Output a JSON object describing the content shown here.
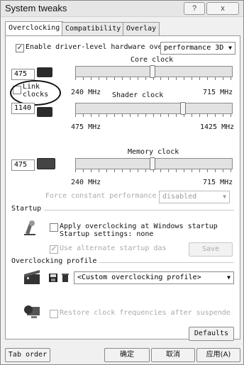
{
  "window": {
    "title": "System tweaks",
    "help_label": "?",
    "close_label": "x"
  },
  "tabs": [
    "Overclocking",
    "Compatibility",
    "Overlay"
  ],
  "overclocking": {
    "enable_label": "Enable driver-level hardware overc",
    "enable_checked": true,
    "profile_mode": "performance 3D",
    "link_clocks_label": "Link clocks",
    "link_clocks_checked": false,
    "core": {
      "title": "Core clock",
      "value": "475",
      "min_label": "240 MHz",
      "max_label": "715 MHz",
      "min": 240,
      "max": 715,
      "current": 475
    },
    "shader": {
      "title": "Shader clock",
      "value": "1140",
      "min_label": "475 MHz",
      "max_label": "1425 MHz",
      "min": 475,
      "max": 1425,
      "current": 1140
    },
    "memory": {
      "title": "Memory clock",
      "value": "475",
      "min_label": "240 MHz",
      "max_label": "715 MHz",
      "min": 240,
      "max": 715,
      "current": 475
    },
    "force_label": "Force constant performance",
    "force_value": "disabled"
  },
  "startup": {
    "group_label": "Startup",
    "apply_label": "Apply overclocking at Windows startup",
    "settings_label": "Startup settings: none",
    "alt_label": "Use alternate startup das",
    "alt_checked": true,
    "save_label": "Save"
  },
  "profile": {
    "group_label": "Overclocking profile",
    "selected": "<Custom overclocking profile>"
  },
  "restore": {
    "label": "Restore clock frequencies after suspende",
    "checked": false
  },
  "buttons": {
    "defaults": "Defaults",
    "tab_order": "Tab order",
    "ok": "确定",
    "cancel": "取消",
    "apply": "应用(A)"
  }
}
